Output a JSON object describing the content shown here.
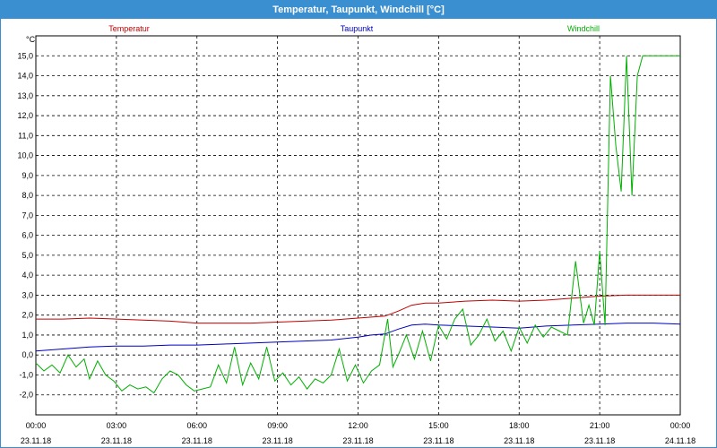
{
  "window": {
    "title": "Temperatur, Taupunkt, Windchill [°C]"
  },
  "colors": {
    "Temperatur": "#c00000",
    "Taupunkt": "#0000c0",
    "Windchill": "#00b000",
    "titlebar": "#3a8fd0"
  },
  "chart_data": {
    "type": "line",
    "title": "Temperatur, Taupunkt, Windchill [°C]",
    "ylabel": "°C",
    "ylim": [
      -3,
      16
    ],
    "xlim": [
      0,
      24
    ],
    "grid": true,
    "legend_position": "top",
    "yticks": [
      "-2,0",
      "-1,0",
      "0,0",
      "1,0",
      "2,0",
      "3,0",
      "4,0",
      "5,0",
      "6,0",
      "7,0",
      "8,0",
      "9,0",
      "10,0",
      "11,0",
      "12,0",
      "13,0",
      "14,0",
      "15,0"
    ],
    "xticks": [
      {
        "time": "00:00",
        "date": "23.11.18"
      },
      {
        "time": "03:00",
        "date": "23.11.18"
      },
      {
        "time": "06:00",
        "date": "23.11.18"
      },
      {
        "time": "09:00",
        "date": "23.11.18"
      },
      {
        "time": "12:00",
        "date": "23.11.18"
      },
      {
        "time": "15:00",
        "date": "23.11.18"
      },
      {
        "time": "18:00",
        "date": "23.11.18"
      },
      {
        "time": "21:00",
        "date": "23.11.18"
      },
      {
        "time": "00:00",
        "date": "24.11.18"
      }
    ],
    "series": [
      {
        "name": "Temperatur",
        "x": [
          0,
          1,
          2,
          3,
          4,
          5,
          6,
          7,
          8,
          9,
          10,
          11,
          12,
          12.5,
          13,
          13.5,
          14,
          14.5,
          15,
          16,
          17,
          18,
          19,
          20,
          21,
          22,
          23,
          24
        ],
        "y": [
          1.8,
          1.8,
          1.85,
          1.8,
          1.75,
          1.7,
          1.6,
          1.6,
          1.6,
          1.65,
          1.7,
          1.75,
          1.85,
          1.9,
          1.95,
          2.2,
          2.5,
          2.6,
          2.6,
          2.7,
          2.75,
          2.7,
          2.75,
          2.85,
          2.95,
          3.0,
          3.0,
          3.0
        ]
      },
      {
        "name": "Taupunkt",
        "x": [
          0,
          1,
          2,
          3,
          4,
          5,
          6,
          7,
          8,
          9,
          10,
          11,
          12,
          12.5,
          13,
          13.5,
          14,
          14.5,
          15,
          16,
          17,
          18,
          19,
          20,
          21,
          22,
          23,
          24
        ],
        "y": [
          0.2,
          0.3,
          0.4,
          0.45,
          0.45,
          0.5,
          0.5,
          0.55,
          0.6,
          0.65,
          0.7,
          0.75,
          0.9,
          1.0,
          1.05,
          1.3,
          1.5,
          1.55,
          1.5,
          1.45,
          1.4,
          1.35,
          1.45,
          1.5,
          1.55,
          1.6,
          1.6,
          1.55
        ]
      },
      {
        "name": "Windchill",
        "x": [
          0,
          0.3,
          0.6,
          0.9,
          1.2,
          1.5,
          1.8,
          2.0,
          2.3,
          2.6,
          2.9,
          3.2,
          3.5,
          3.8,
          4.1,
          4.4,
          4.7,
          5.0,
          5.3,
          5.6,
          5.9,
          6.2,
          6.5,
          6.8,
          7.1,
          7.4,
          7.7,
          8.0,
          8.3,
          8.6,
          8.9,
          9.2,
          9.5,
          9.8,
          10.1,
          10.4,
          10.7,
          11.0,
          11.3,
          11.6,
          11.9,
          12.2,
          12.5,
          12.8,
          13.1,
          13.3,
          13.5,
          13.8,
          14.1,
          14.4,
          14.7,
          15.0,
          15.3,
          15.6,
          15.9,
          16.2,
          16.5,
          16.8,
          17.1,
          17.4,
          17.7,
          18.0,
          18.3,
          18.6,
          18.9,
          19.2,
          19.5,
          19.8,
          20.1,
          20.4,
          20.6,
          20.8,
          21.0,
          21.2,
          21.4,
          21.6,
          21.8,
          22.0,
          22.2,
          22.4,
          22.6,
          22.8,
          23.0,
          23.2,
          23.4,
          23.6,
          23.8,
          24.0
        ],
        "y": [
          -0.4,
          -0.8,
          -0.5,
          -0.9,
          0.0,
          -0.6,
          -0.2,
          -1.2,
          -0.3,
          -1.0,
          -1.3,
          -1.8,
          -1.5,
          -1.7,
          -1.6,
          -1.9,
          -1.2,
          -0.8,
          -1.0,
          -1.5,
          -1.8,
          -1.7,
          -1.6,
          -0.5,
          -1.4,
          0.4,
          -1.5,
          -0.4,
          -1.2,
          0.4,
          -1.3,
          -0.9,
          -1.5,
          -1.1,
          -1.7,
          -1.2,
          -1.4,
          -1.0,
          0.3,
          -1.3,
          -0.5,
          -1.4,
          -0.8,
          -0.5,
          1.8,
          -0.6,
          0.0,
          1.0,
          -0.2,
          1.2,
          -0.3,
          1.5,
          0.8,
          1.8,
          2.3,
          0.5,
          1.0,
          1.8,
          0.7,
          1.2,
          0.2,
          1.4,
          0.6,
          1.5,
          0.9,
          1.4,
          1.2,
          1.0,
          4.7,
          1.6,
          2.5,
          1.5,
          5.2,
          1.5,
          14.0,
          10.5,
          8.2,
          15.0,
          8.0,
          14.0,
          15.0,
          15.0,
          15.0,
          15.0,
          15.0,
          15.0,
          15.0,
          15.0
        ]
      }
    ]
  }
}
